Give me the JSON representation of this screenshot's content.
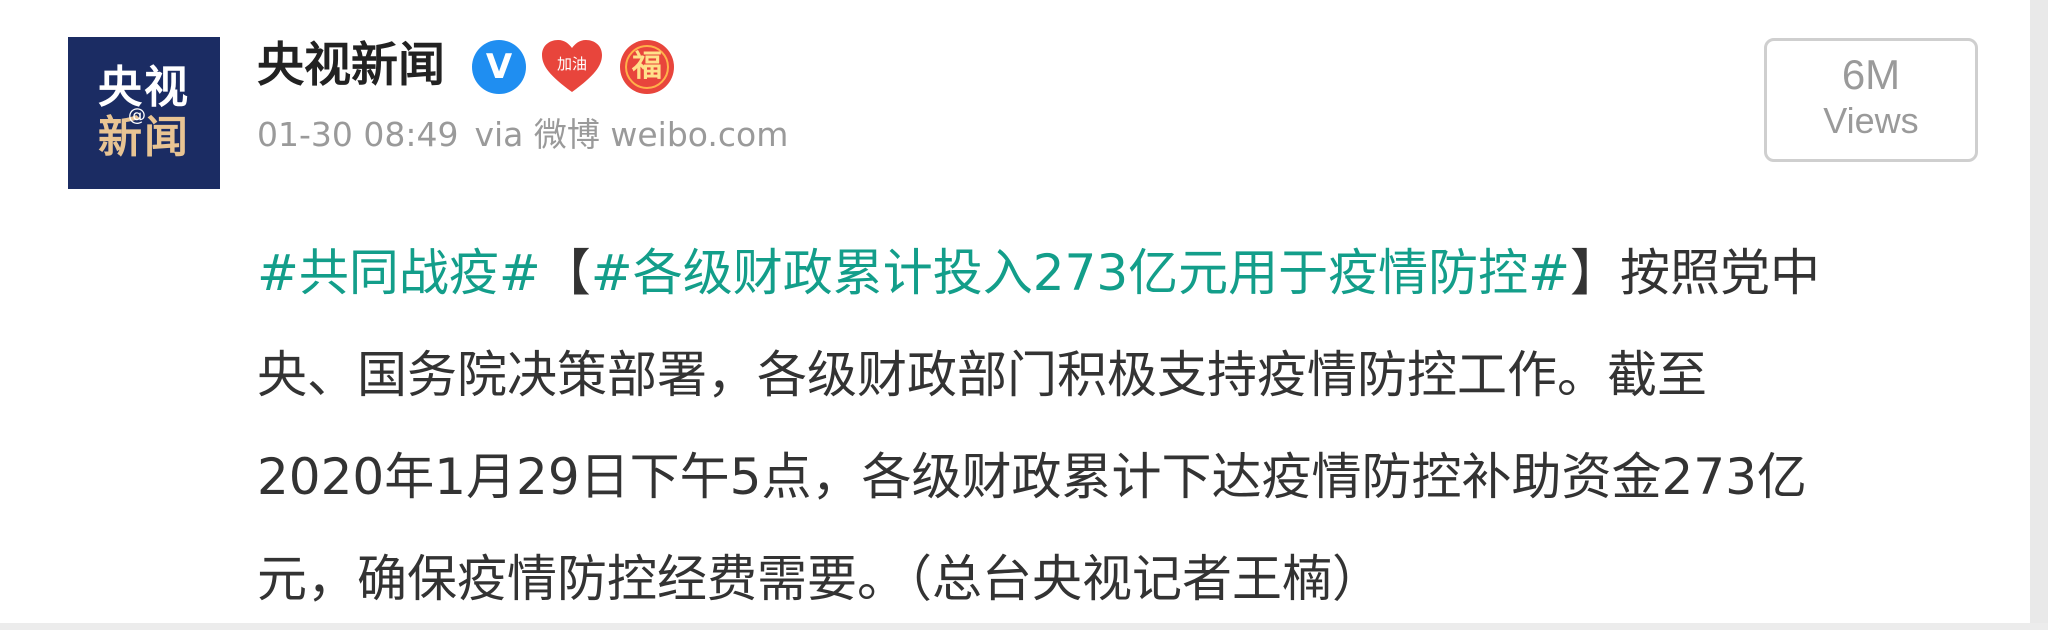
{
  "account": {
    "avatar_line1": "央视",
    "avatar_line2": "新闻",
    "avatar_at": "@",
    "username": "央视新闻",
    "verified_badge": "V",
    "badge_jiayou": "加油",
    "badge_fu": "福"
  },
  "meta": {
    "time": "01-30 08:49",
    "source": "via 微博 weibo.com"
  },
  "views": {
    "count": "6M",
    "label": "Views"
  },
  "post": {
    "topic1": "#共同战疫#",
    "bracket_open": "【",
    "topic2": "#各级财政累计投入273亿元用于疫情防控#",
    "bracket_close": "】",
    "line1_rest": "按照党中",
    "line2": "央、国务院决策部署，各级财政部门积极支持疫情防控工作。截至",
    "line3": "2020年1月29日下午5点，各级财政累计下达疫情防控补助资金273亿",
    "line4": "元，确保疫情防控经费需要。（总台央视记者王楠）"
  },
  "colors": {
    "topic": "#139e8a",
    "avatar_bg": "#1b2c63",
    "verified": "#1f8ef1",
    "badge_red": "#e8453c"
  },
  "icons": [
    "verified-icon",
    "jiayou-heart-icon",
    "fu-badge-icon"
  ]
}
